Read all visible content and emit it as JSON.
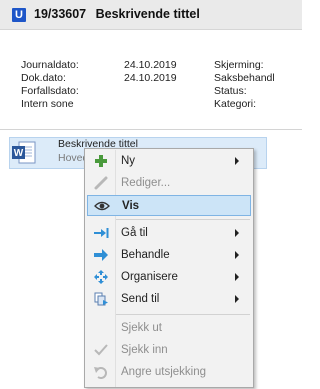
{
  "header": {
    "badge": "U",
    "journal_number": "19/33607",
    "title": "Beskrivende tittel"
  },
  "meta": {
    "left": [
      {
        "label": "Journaldato:",
        "value": "24.10.2019"
      },
      {
        "label": "Dok.dato:",
        "value": "24.10.2019"
      },
      {
        "label": "Forfallsdato:",
        "value": ""
      },
      {
        "label": "Intern sone",
        "value": ""
      }
    ],
    "right": [
      "Skjerming:",
      "Saksbehandl",
      "Status:",
      "Kategori:"
    ]
  },
  "document": {
    "title": "Beskrivende tittel",
    "subtitle": "Hoved"
  },
  "menu": {
    "items": [
      {
        "label": "Ny",
        "icon": "plus-icon",
        "submenu": true,
        "disabled": false
      },
      {
        "label": "Rediger...",
        "icon": "pencil-icon",
        "submenu": false,
        "disabled": true
      },
      {
        "label": "Vis",
        "icon": "eye-icon",
        "submenu": false,
        "disabled": false,
        "highlighted": true
      },
      {
        "label": "Gå til",
        "icon": "goto-icon",
        "submenu": true,
        "disabled": false
      },
      {
        "label": "Behandle",
        "icon": "process-arrow-icon",
        "submenu": true,
        "disabled": false
      },
      {
        "label": "Organisere",
        "icon": "organize-icon",
        "submenu": true,
        "disabled": false
      },
      {
        "label": "Send til",
        "icon": "send-to-icon",
        "submenu": true,
        "disabled": false
      },
      {
        "label": "Sjekk ut",
        "icon": "",
        "submenu": false,
        "disabled": true
      },
      {
        "label": "Sjekk inn",
        "icon": "checkmark-icon",
        "submenu": false,
        "disabled": true
      },
      {
        "label": "Angre utsjekking",
        "icon": "undo-icon",
        "submenu": false,
        "disabled": true
      }
    ]
  },
  "colors": {
    "badge": "#1e56c8",
    "highlight": "#cce4f7",
    "highlight_border": "#7fb4e4",
    "plus_green": "#4a9a3c",
    "arrow_blue": "#2f8fd6"
  }
}
